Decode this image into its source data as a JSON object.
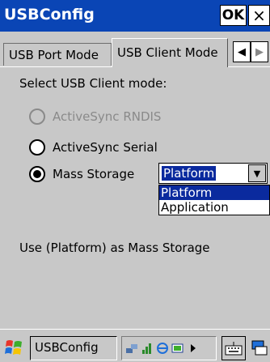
{
  "window": {
    "title": "USBConfig",
    "ok_label": "OK",
    "close_label": "×"
  },
  "tabs": [
    {
      "label": "USB Port Mode",
      "active": false
    },
    {
      "label": "USB Client Mode",
      "active": true
    }
  ],
  "tab_scroll": {
    "left": "◀",
    "right": "▶"
  },
  "panel": {
    "prompt": "Select USB Client mode:",
    "options": [
      {
        "label": "ActiveSync RNDIS",
        "checked": false,
        "enabled": false
      },
      {
        "label": "ActiveSync Serial",
        "checked": false,
        "enabled": true
      },
      {
        "label": "Mass Storage",
        "checked": true,
        "enabled": true
      }
    ],
    "combo": {
      "value": "Platform",
      "arrow": "▼",
      "options": [
        "Platform",
        "Application"
      ],
      "highlighted": "Platform"
    },
    "status": "Use (Platform) as Mass Storage"
  },
  "taskbar": {
    "task_label": "USBConfig",
    "icons": [
      "windows-start-icon",
      "network-icon",
      "signal-icon",
      "connection-icon",
      "battery-icon",
      "keyboard-icon",
      "desktop-icon"
    ]
  },
  "colors": {
    "titlebar": "#0a45b5",
    "selection": "#0a2a9e",
    "background": "#c8c8c8"
  }
}
